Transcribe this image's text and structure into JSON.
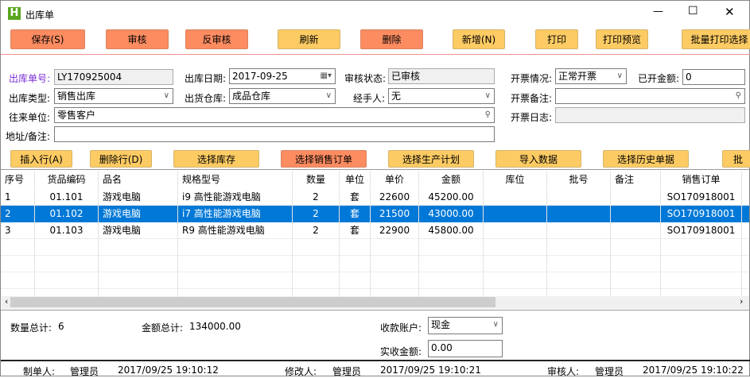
{
  "window": {
    "title": "出库单",
    "app_icon": "H",
    "minimize": "—",
    "maximize": "☐",
    "close": "✕"
  },
  "toolbar": [
    {
      "label": "保存(S)",
      "color": "orange"
    },
    {
      "label": "审核",
      "color": "orange"
    },
    {
      "label": "反审核",
      "color": "orange"
    },
    {
      "label": "刷新",
      "color": "yellow"
    },
    {
      "label": "删除",
      "color": "orange"
    },
    {
      "label": "新增(N)",
      "color": "yellow"
    },
    {
      "label": "打印",
      "color": "yellow"
    },
    {
      "label": "打印预览",
      "color": "yellow"
    },
    {
      "label": "批量打印选择",
      "color": "yellow"
    }
  ],
  "form": {
    "order_no_label": "出库单号:",
    "order_no": "LY170925004",
    "date_label": "出库日期:",
    "date": "2017-09-25",
    "audit_status_label": "审核状态:",
    "audit_status": "已审核",
    "invoice_status_label": "开票情况:",
    "invoice_status": "正常开票",
    "invoiced_amount_label": "已开金额:",
    "invoiced_amount": "0",
    "type_label": "出库类型:",
    "type": "销售出库",
    "warehouse_label": "出货仓库:",
    "warehouse": "成品仓库",
    "handler_label": "经手人:",
    "handler": "无",
    "invoice_note_label": "开票备注:",
    "invoice_note": "",
    "partner_label": "往来单位:",
    "partner": "零售客户",
    "invoice_log_label": "开票日志:",
    "invoice_log": "",
    "address_label": "地址/备注:",
    "address": ""
  },
  "actions": [
    {
      "label": "插入行(A)",
      "color": "yellow"
    },
    {
      "label": "删除行(D)",
      "color": "yellow"
    },
    {
      "label": "选择库存",
      "color": "yellow"
    },
    {
      "label": "选择销售订单",
      "color": "orange"
    },
    {
      "label": "选择生产计划",
      "color": "yellow"
    },
    {
      "label": "导入数据",
      "color": "yellow"
    },
    {
      "label": "选择历史单据",
      "color": "yellow"
    },
    {
      "label": "批",
      "color": "yellow"
    }
  ],
  "table": {
    "columns": [
      "序号",
      "货品编码",
      "品名",
      "规格型号",
      "数量",
      "单位",
      "单价",
      "金额",
      "库位",
      "批号",
      "备注",
      "销售订单"
    ],
    "rows": [
      [
        "1",
        "01.101",
        "游戏电脑",
        "i9 高性能游戏电脑",
        "2",
        "套",
        "22600",
        "45200.00",
        "",
        "",
        "",
        "SO170918001"
      ],
      [
        "2",
        "01.102",
        "游戏电脑",
        "i7 高性能游戏电脑",
        "2",
        "套",
        "21500",
        "43000.00",
        "",
        "",
        "",
        "SO170918001"
      ],
      [
        "3",
        "01.103",
        "游戏电脑",
        "R9 高性能游戏电脑",
        "2",
        "套",
        "22900",
        "45800.00",
        "",
        "",
        "",
        "SO170918001"
      ]
    ],
    "selected_row": 1
  },
  "summary": {
    "qty_label": "数量总计:",
    "qty": "6",
    "amount_label": "金额总计:",
    "amount": "134000.00",
    "account_label": "收款账户:",
    "account": "现金",
    "received_label": "实收金额:",
    "received": "0.00"
  },
  "status": {
    "creator_label": "制单人:",
    "creator": "管理员",
    "created": "2017/09/25 19:10:12",
    "modifier_label": "修改人:",
    "modifier": "管理员",
    "modified": "2017/09/25 19:10:21",
    "auditor_label": "审核人:",
    "auditor": "管理员",
    "audited": "2017/09/25 19:10:22"
  },
  "colors": {
    "orange": "#fd8c61",
    "yellow": "#fdcb63",
    "selection": "#0078d7",
    "label_accent": "#7b2fd6"
  }
}
